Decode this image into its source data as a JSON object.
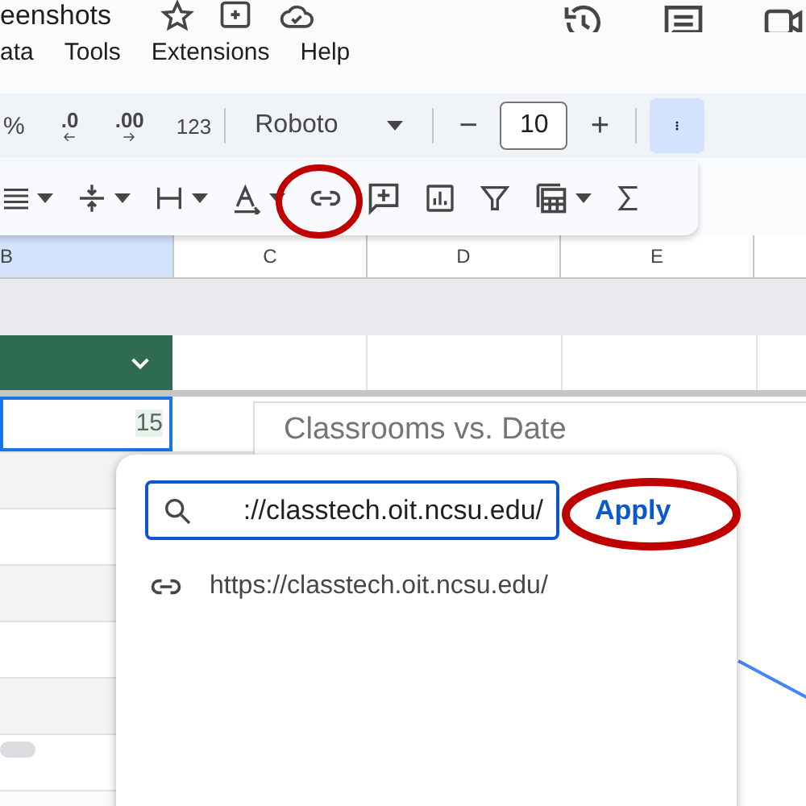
{
  "document": {
    "title": "eenshots"
  },
  "menu": [
    "ata",
    "Tools",
    "Extensions",
    "Help"
  ],
  "toolbar": {
    "percent": "%",
    "decrease_decimals": ".0",
    "increase_decimals": ".00",
    "number_format": "123",
    "font": "Roboto",
    "font_size": "10",
    "decrease_size": "−",
    "increase_size": "+",
    "more_selected": true
  },
  "columns": [
    {
      "label": "B",
      "selected": true
    },
    {
      "label": "C",
      "selected": false
    },
    {
      "label": "D",
      "selected": false
    },
    {
      "label": "E",
      "selected": false
    }
  ],
  "cell": {
    "value": "15",
    "selected": true
  },
  "chart": {
    "title": "Classrooms vs. Date"
  },
  "link_popup": {
    "value": "://classtech.oit.ncsu.edu/",
    "apply": "Apply",
    "suggestion": "https://classtech.oit.ncsu.edu/"
  }
}
